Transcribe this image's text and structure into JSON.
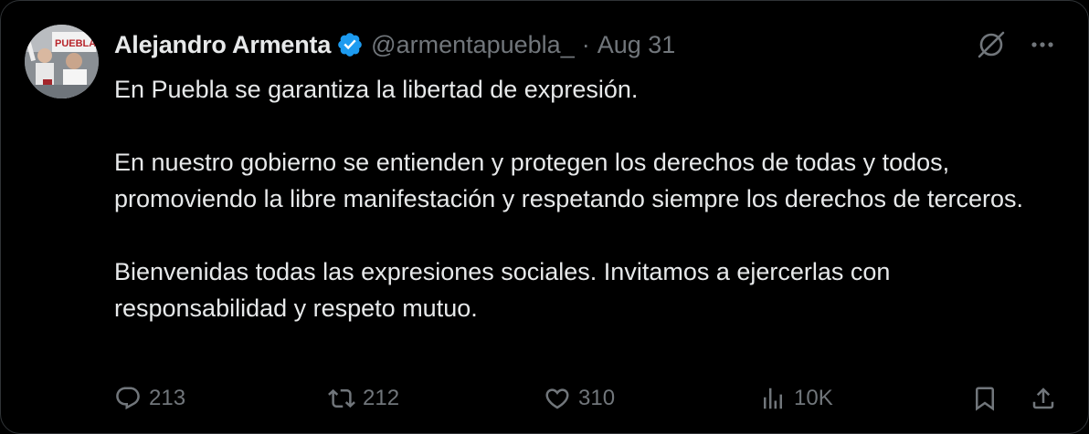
{
  "author": {
    "name": "Alejandro Armenta",
    "handle": "@armentapuebla_",
    "separator": "·",
    "date": "Aug 31",
    "verified": true,
    "avatar_text": "PUEBLA"
  },
  "tweet": {
    "paragraphs": [
      "En Puebla se garantiza la libertad de expresión.",
      "En nuestro gobierno se entienden y protegen los derechos de todas y todos, promoviendo la libre manifestación y respetando siempre los derechos de terceros.",
      "Bienvenidas todas las expresiones sociales. Invitamos a ejercerlas con responsabilidad y respeto mutuo."
    ]
  },
  "metrics": {
    "replies": "213",
    "reposts": "212",
    "likes": "310",
    "views": "10K"
  },
  "icons": {
    "verified": "verified-badge-icon",
    "grok": "grok-icon",
    "more": "more-dots-icon",
    "reply": "reply-icon",
    "repost": "repost-icon",
    "like": "heart-icon",
    "views": "views-icon",
    "bookmark": "bookmark-icon",
    "share": "share-icon"
  },
  "colors": {
    "background": "#000000",
    "text": "#e7e9ea",
    "secondary": "#71767b",
    "verified": "#1d9bf0"
  }
}
